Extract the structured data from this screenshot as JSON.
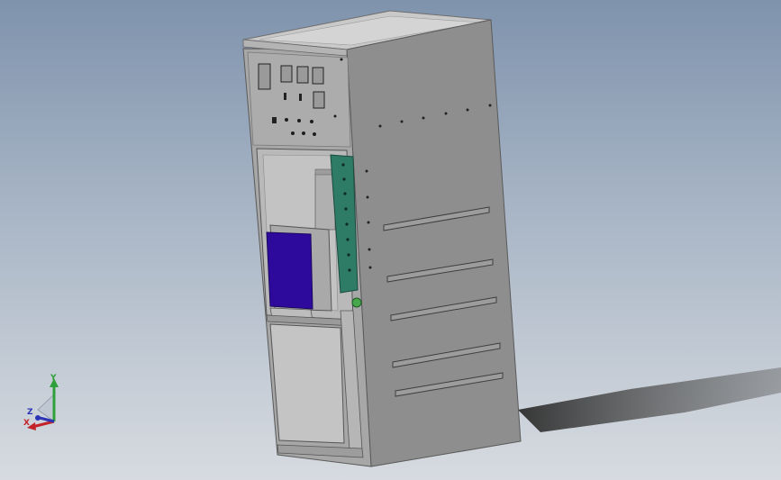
{
  "viewport": {
    "background_top": "#7f93ad",
    "background_bottom": "#d7dbe0"
  },
  "model": {
    "type": "3D cabinet assembly",
    "colors": {
      "side_panel": "#8e8e8e",
      "front_frame": "#a7a7a7",
      "top_panel": "#c9c9c9",
      "interior": "#b9b9b9",
      "mounting_bracket": "#2e7c66",
      "breaker_face": "#2d0a9c",
      "shadow": "#3a3a3a"
    }
  },
  "triad": {
    "x_label": "X",
    "y_label": "Y",
    "z_label": "Z",
    "icons": [
      "axis-x-arrow-icon",
      "axis-y-arrow-icon",
      "axis-z-arrow-icon"
    ]
  }
}
